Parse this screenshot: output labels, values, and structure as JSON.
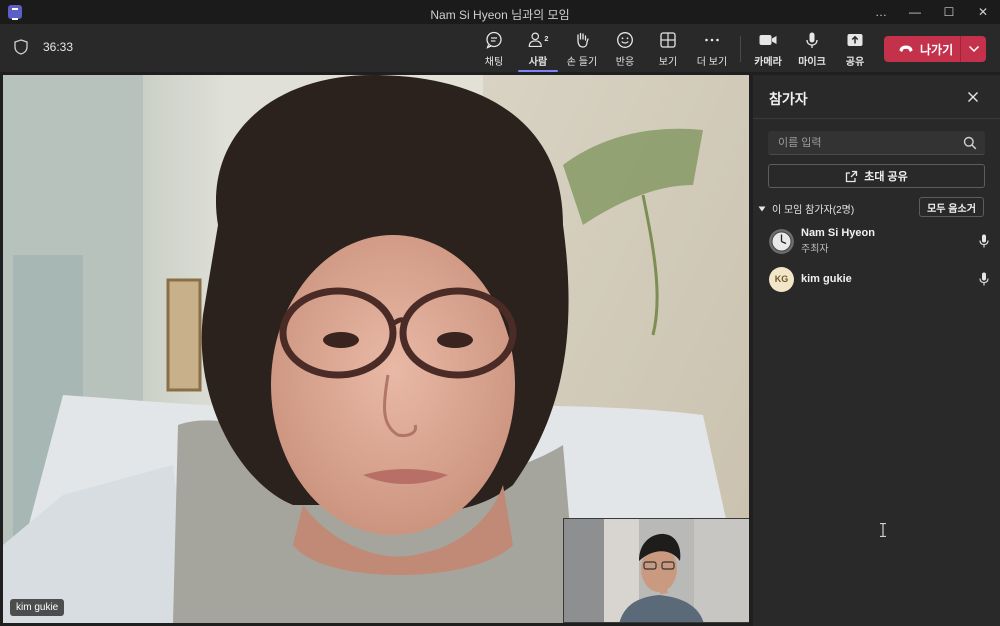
{
  "window": {
    "title": "Nam Si Hyeon 님과의 모임",
    "controls": [
      "…",
      "—",
      "☐",
      "✕"
    ]
  },
  "toolbar": {
    "timer": "36:33",
    "items": [
      {
        "label": "채팅",
        "icon": "chat-icon"
      },
      {
        "label": "사람",
        "icon": "people-icon",
        "badge": "2",
        "active": true
      },
      {
        "label": "손 들기",
        "icon": "raise-hand-icon"
      },
      {
        "label": "반응",
        "icon": "reaction-icon"
      },
      {
        "label": "보기",
        "icon": "view-icon"
      },
      {
        "label": "더 보기",
        "icon": "more-icon"
      },
      {
        "label": "카메라",
        "icon": "camera-icon"
      },
      {
        "label": "마이크",
        "icon": "mic-icon"
      },
      {
        "label": "공유",
        "icon": "share-icon"
      }
    ],
    "leave_label": "나가기",
    "leave_color": "#c4314b",
    "accent_color": "#7f85f5"
  },
  "stage": {
    "main_name_tag": "kim gukie"
  },
  "panel": {
    "title": "참가자",
    "search_placeholder": "이름 입력",
    "invite_label": "초대 공유",
    "section_label": "이 모임 참가자(2명)",
    "mute_all_label": "모두 음소거",
    "participants": [
      {
        "name": "Nam Si Hyeon",
        "role": "주최자",
        "avatar": "clock-photo"
      },
      {
        "name": "kim gukie",
        "role": "",
        "initials": "KG"
      }
    ]
  }
}
